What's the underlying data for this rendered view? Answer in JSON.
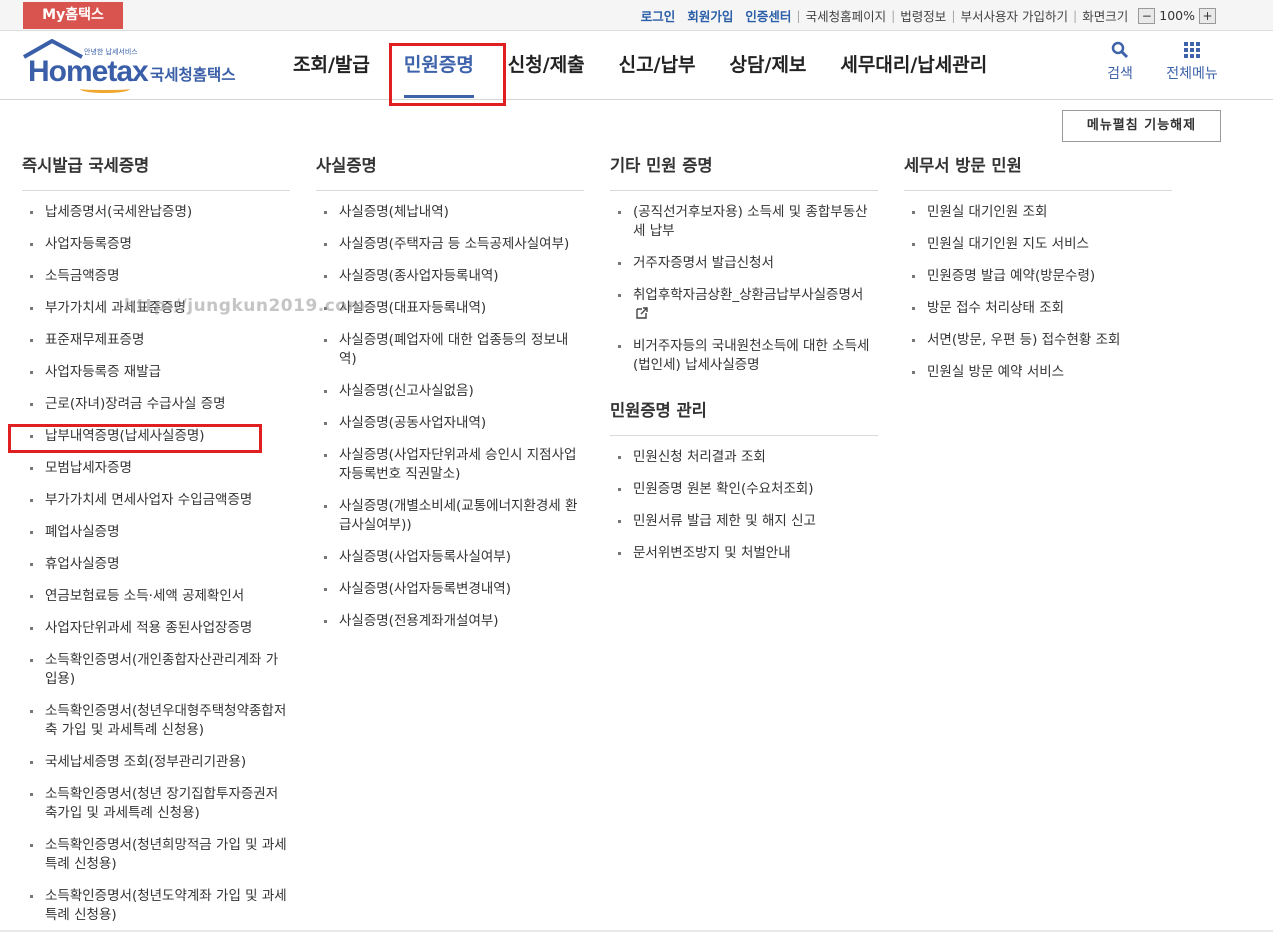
{
  "topbar": {
    "mytax": "My홈택스",
    "links_blue": [
      "로그인",
      "회원가입",
      "인증센터"
    ],
    "links_gray": [
      "국세청홈페이지",
      "법령정보",
      "부서사용자 가입하기",
      "화면크기"
    ],
    "zoom_minus": "−",
    "zoom_value": "100%",
    "zoom_plus": "+"
  },
  "logo": {
    "brand": "Hometax",
    "sub": "안녕한 납세서비스",
    "ko": "국세청홈택스"
  },
  "gnb": {
    "items": [
      "조회/발급",
      "민원증명",
      "신청/제출",
      "신고/납부",
      "상담/제보",
      "세무대리/납세관리"
    ],
    "active_index": 1,
    "search": "검색",
    "allmenu": "전체메뉴"
  },
  "toggle_label": "메뉴펼침 기능해제",
  "watermark": "http://jungkun2019.com",
  "columns": [
    {
      "title": "즉시발급 국세증명",
      "items": [
        "납세증명서(국세완납증명)",
        "사업자등록증명",
        "소득금액증명",
        "부가가치세 과세표준증명",
        "표준재무제표증명",
        "사업자등록증 재발급",
        "근로(자녀)장려금 수급사실 증명",
        "납부내역증명(납세사실증명)",
        "모범납세자증명",
        "부가가치세 면세사업자 수입금액증명",
        "폐업사실증명",
        "휴업사실증명",
        "연금보험료등 소득·세액 공제확인서",
        "사업자단위과세 적용 종된사업장증명",
        "소득확인증명서(개인종합자산관리계좌 가입용)",
        "소득확인증명서(청년우대형주택청약종합저축 가입 및 과세특례 신청용)",
        "국세납세증명 조회(정부관리기관용)",
        "소득확인증명서(청년 장기집합투자증권저축가입 및 과세특례 신청용)",
        "소득확인증명서(청년희망적금 가입 및 과세특례 신청용)",
        "소득확인증명서(청년도약계좌 가입 및 과세특례 신청용)"
      ]
    },
    {
      "title": "사실증명",
      "items": [
        "사실증명(체납내역)",
        "사실증명(주택자금 등 소득공제사실여부)",
        "사실증명(종사업자등록내역)",
        "사실증명(대표자등록내역)",
        "사실증명(폐업자에 대한 업종등의 정보내역)",
        "사실증명(신고사실없음)",
        "사실증명(공동사업자내역)",
        "사실증명(사업자단위과세 승인시 지점사업자등록번호 직권말소)",
        "사실증명(개별소비세(교통에너지환경세 환급사실여부))",
        "사실증명(사업자등록사실여부)",
        "사실증명(사업자등록변경내역)",
        "사실증명(전용계좌개설여부)"
      ]
    },
    {
      "title": "기타 민원 증명",
      "items": [
        "(공직선거후보자용) 소득세 및 종합부동산세 납부",
        "거주자증명서 발급신청서",
        "취업후학자금상환_상환금납부사실증명서",
        "비거주자등의 국내원천소득에 대한 소득세(법인세) 납세사실증명"
      ],
      "title2": "민원증명 관리",
      "items2": [
        "민원신청 처리결과 조회",
        "민원증명 원본 확인(수요처조회)",
        "민원서류 발급 제한 및 해지 신고",
        "문서위변조방지 및 처벌안내"
      ]
    },
    {
      "title": "세무서 방문 민원",
      "items": [
        "민원실 대기인원 조회",
        "민원실 대기인원 지도 서비스",
        "민원증명 발급 예약(방문수령)",
        "방문 접수 처리상태 조회",
        "서면(방문, 우편 등) 접수현황 조회",
        "민원실 방문 예약 서비스"
      ]
    }
  ],
  "highlight_color": "#e02020",
  "accent_color": "#3e63ab"
}
